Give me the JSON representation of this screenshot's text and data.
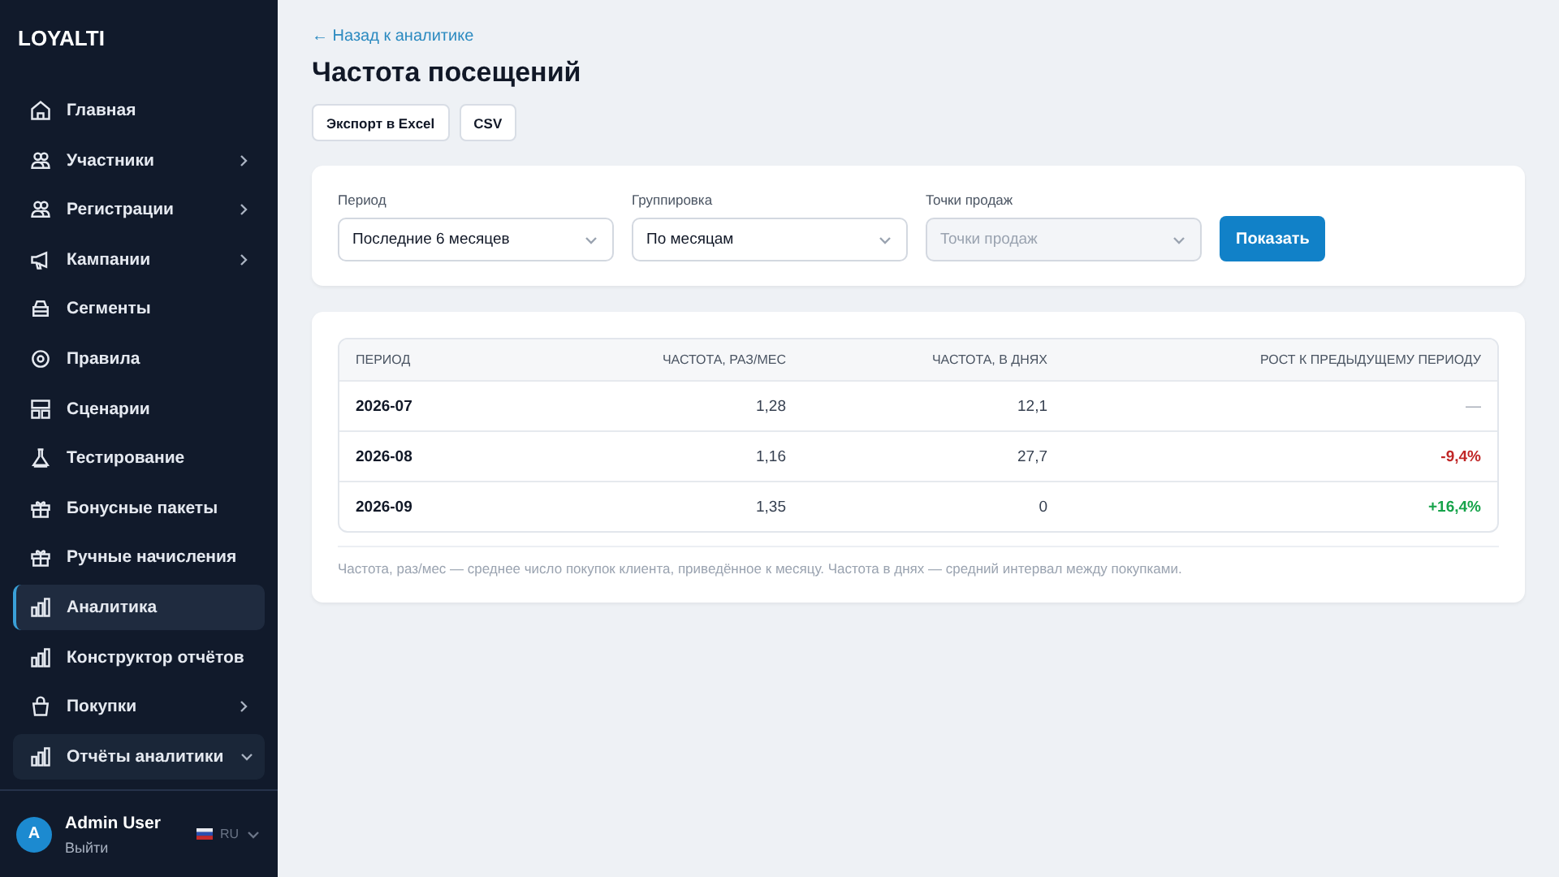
{
  "sidebar": {
    "logo": "LOYALTI",
    "items": [
      {
        "label": "Главная",
        "kind": "home",
        "selected": false
      },
      {
        "label": "Участники",
        "kind": "users",
        "selected": false,
        "expanded": false
      },
      {
        "label": "Регистрации",
        "kind": "users",
        "selected": false,
        "expanded": false
      },
      {
        "label": "Кампании",
        "kind": "megaphone",
        "selected": false,
        "expanded": false
      },
      {
        "label": "Сегменты",
        "kind": "box",
        "selected": false
      },
      {
        "label": "Правила",
        "kind": "gear",
        "selected": false
      },
      {
        "label": "Сценарии",
        "kind": "layout",
        "selected": false
      },
      {
        "label": "Тестирование",
        "kind": "flask",
        "selected": false
      },
      {
        "label": "Бонусные пакеты",
        "kind": "gift",
        "selected": false
      },
      {
        "label": "Ручные начисления",
        "kind": "gift",
        "selected": false
      },
      {
        "label": "Аналитика",
        "kind": "chart",
        "selected": true
      },
      {
        "label": "Конструктор отчётов",
        "kind": "chart",
        "selected": false
      },
      {
        "label": "Покупки",
        "kind": "bag",
        "selected": false,
        "expanded": false
      },
      {
        "label": "Отчёты аналитики",
        "kind": "chart",
        "selected": false,
        "expanded": true
      }
    ],
    "user": {
      "initial": "A",
      "name": "Admin User",
      "logout": "Выйти",
      "language": "RU"
    }
  },
  "back_link": "← Назад к аналитике",
  "title": "Частота посещений",
  "export_buttons": [
    "Экспорт в Excel",
    "CSV"
  ],
  "filters": [
    {
      "label": "Период",
      "value": "Последние 6 месяцев",
      "disabled": false
    },
    {
      "label": "Группировка",
      "value": "По месяцам",
      "disabled": false
    },
    {
      "label": "Точки продаж",
      "placeholder": "Точки продаж",
      "disabled": true
    }
  ],
  "show_button": "Показать",
  "table": {
    "columns": [
      "ПЕРИОД",
      "ЧАСТОТА, РАЗ/МЕС",
      "ЧАСТОТА, В ДНЯХ",
      "РОСТ К ПРЕДЫДУЩЕМУ ПЕРИОДУ"
    ],
    "rows": [
      {
        "period": "2026-07",
        "per_month": "1,28",
        "days": "12,1",
        "growth": "—",
        "kind": "neutral"
      },
      {
        "period": "2026-08",
        "per_month": "1,16",
        "days": "27,7",
        "growth": "-9,4%",
        "kind": "down"
      },
      {
        "period": "2026-09",
        "per_month": "1,35",
        "days": "0",
        "growth": "+16,4%",
        "kind": "up"
      }
    ]
  },
  "footnote": "Частота, раз/мес — среднее число покупок клиента, приведённое к месяцу. Частота в днях — средний интервал между покупками."
}
